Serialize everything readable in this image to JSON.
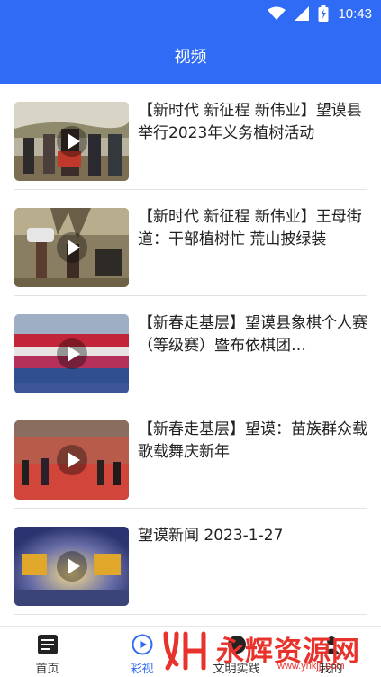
{
  "status_bar": {
    "time": "10:43",
    "icons": [
      "wifi-icon",
      "signal-icon",
      "battery-icon"
    ]
  },
  "header": {
    "title": "视频"
  },
  "videos": [
    {
      "title": "【新时代 新征程 新伟业】望谟县举行2023年义务植树活动",
      "thumbnail": "tree-planting-officials"
    },
    {
      "title": "【新时代 新征程 新伟业】王母街道：干部植树忙 荒山披绿装",
      "thumbnail": "hillside-planting"
    },
    {
      "title": "【新春走基层】望谟县象棋个人赛（等级赛）暨布依棋团…",
      "thumbnail": "chess-group-photo"
    },
    {
      "title": "【新春走基层】望谟：苗族群众载歌载舞庆新年",
      "thumbnail": "stage-dance"
    },
    {
      "title": "望谟新闻 2023-1-27",
      "thumbnail": "news-title-card"
    }
  ],
  "tabs": [
    {
      "label": "首页",
      "icon": "news-icon",
      "active": false
    },
    {
      "label": "彩视",
      "icon": "play-circle-icon",
      "active": true
    },
    {
      "label": "文明实践",
      "icon": "practice-icon",
      "active": false
    },
    {
      "label": "我的",
      "icon": "person-icon",
      "active": false
    }
  ],
  "watermark": {
    "text": "永辉资源网",
    "url": "www.yhkjjj.com"
  },
  "colors": {
    "brand_blue": "#2f6bf5",
    "divider": "#e3e3e3",
    "watermark_red": "#e8322c"
  }
}
